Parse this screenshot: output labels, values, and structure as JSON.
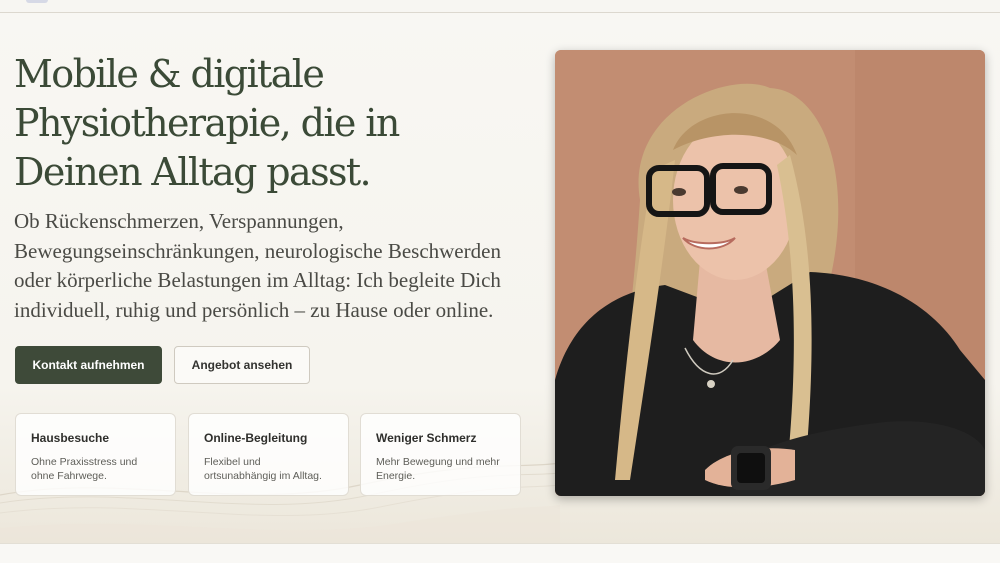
{
  "hero": {
    "title": "Mobile & digitale Physiotherapie, die in Deinen Alltag passt.",
    "lead": "Ob Rückenschmerzen, Verspannungen, Bewegungseinschränkungen, neurologische Beschwerden oder körperliche Belastungen im Alltag: Ich begleite Dich individuell, ruhig und persönlich – zu Hause oder online.",
    "primary_button": "Kontakt aufnehmen",
    "secondary_button": "Angebot ansehen"
  },
  "features": [
    {
      "title": "Hausbesuche",
      "text": "Ohne Praxisstress und ohne Fahrwege."
    },
    {
      "title": "Online-Begleitung",
      "text": "Flexibel und ortsunabhängig im Alltag."
    },
    {
      "title": "Weniger Schmerz",
      "text": "Mehr Bewegung und mehr Energie."
    }
  ],
  "colors": {
    "accent": "#3e4a39",
    "heading": "#3b4a37",
    "background": "#f6f4ee",
    "photo_backdrop": "#c08b70"
  }
}
